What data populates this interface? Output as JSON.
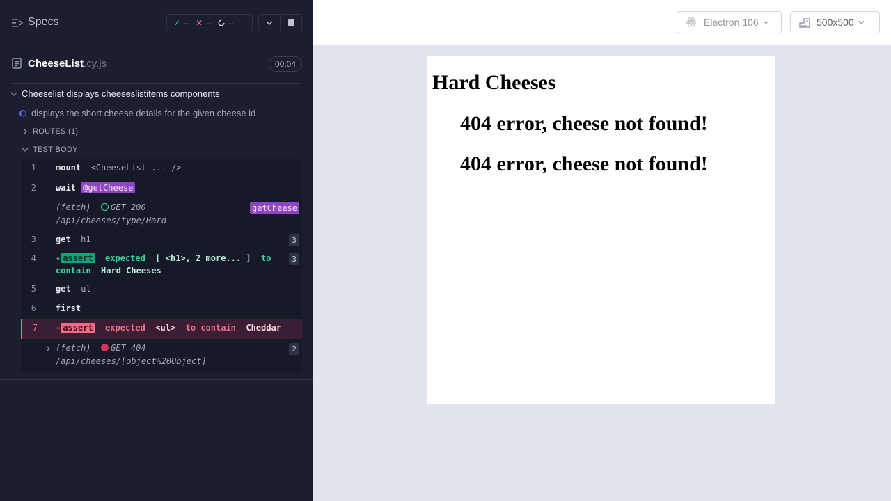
{
  "reporter": {
    "specs_label": "Specs",
    "stats": {
      "passed": "--",
      "failed": "--",
      "pending": "--"
    },
    "file": {
      "name": "CheeseList",
      "ext": ".cy.js",
      "duration": "00:04"
    },
    "suite_title": "Cheeselist displays cheeseslistitems components",
    "test_title": "displays the short cheese details for the given cheese id",
    "routes_label": "ROUTES (1)",
    "test_body_label": "TEST BODY",
    "commands": {
      "c1": {
        "num": "1",
        "name": "mount",
        "arg": "<CheeseList ... />"
      },
      "c2": {
        "num": "2",
        "name": "wait",
        "alias": "@getCheese"
      },
      "c2b": {
        "label": "(fetch)",
        "method": "GET 200",
        "url": "/api/cheeses/type/Hard",
        "alias": "getCheese"
      },
      "c3": {
        "num": "3",
        "name": "get",
        "arg": "h1",
        "count": "3"
      },
      "c4": {
        "num": "4",
        "prefix": "-",
        "name": "assert",
        "l1": "expected",
        "v1": "[ <h1>, 2 more... ]",
        "l2": "to",
        "l3": "contain",
        "v2": "Hard Cheeses",
        "count": "3"
      },
      "c5": {
        "num": "5",
        "name": "get",
        "arg": "ul"
      },
      "c6": {
        "num": "6",
        "name": "first"
      },
      "c7": {
        "num": "7",
        "prefix": "-",
        "name": "assert",
        "l1": "expected",
        "v1": "<ul>",
        "l2": "to contain",
        "v2": "Cheddar"
      },
      "c8": {
        "label": "(fetch)",
        "method": "GET 404",
        "url": "/api/cheeses/[object%20Object]",
        "count": "2"
      }
    }
  },
  "aut": {
    "browser": "Electron 106",
    "viewport": "500x500",
    "heading": "Hard Cheeses",
    "items": [
      "404 error, cheese not found!",
      "404 error, cheese not found!"
    ]
  },
  "colors": {
    "accent_pass": "#3ed6a3",
    "accent_fail": "#f06b85",
    "alias": "#8e44c4",
    "panel_bg": "#1b1e2e"
  },
  "icons": [
    "specs-icon",
    "check-icon",
    "x-icon",
    "spinner-icon",
    "chevron-down-icon",
    "stop-icon",
    "file-icon",
    "chevron-right-icon",
    "electron-icon",
    "ruler-icon"
  ]
}
